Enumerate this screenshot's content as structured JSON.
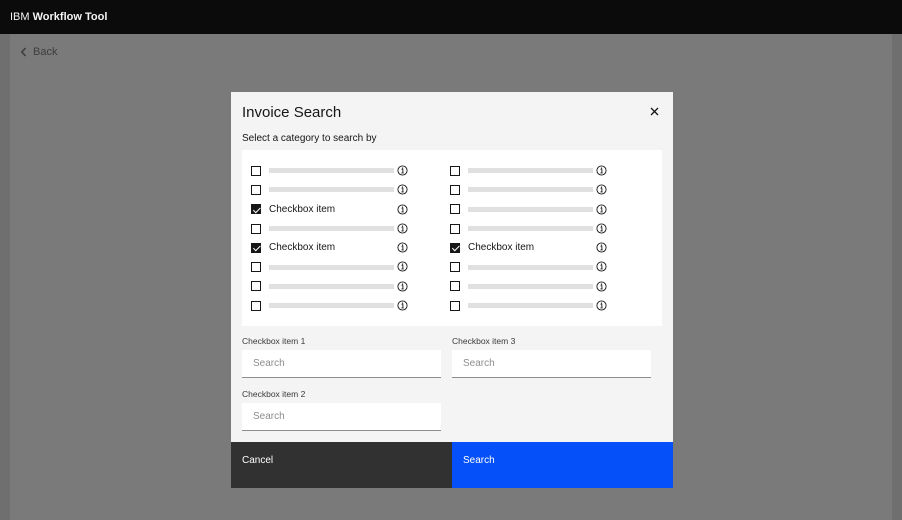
{
  "header": {
    "brand_prefix": "IBM",
    "brand_name": "Workflow Tool"
  },
  "nav": {
    "back_label": "Back"
  },
  "modal": {
    "title": "Invoice Search",
    "subtitle": "Select a category to search by",
    "checkboxes": {
      "left": [
        {
          "label": "",
          "checked": false
        },
        {
          "label": "",
          "checked": false
        },
        {
          "label": "Checkbox item",
          "checked": true
        },
        {
          "label": "",
          "checked": false
        },
        {
          "label": "Checkbox item",
          "checked": true
        },
        {
          "label": "",
          "checked": false
        },
        {
          "label": "",
          "checked": false
        },
        {
          "label": "",
          "checked": false
        }
      ],
      "right": [
        {
          "label": "",
          "checked": false
        },
        {
          "label": "",
          "checked": false
        },
        {
          "label": "",
          "checked": false
        },
        {
          "label": "",
          "checked": false
        },
        {
          "label": "Checkbox item",
          "checked": true
        },
        {
          "label": "",
          "checked": false
        },
        {
          "label": "",
          "checked": false
        },
        {
          "label": "",
          "checked": false
        }
      ]
    },
    "fields": [
      {
        "label": "Checkbox item 1",
        "placeholder": "Search",
        "value": ""
      },
      {
        "label": "Checkbox item 3",
        "placeholder": "Search",
        "value": ""
      },
      {
        "label": "Checkbox item 2",
        "placeholder": "Search",
        "value": ""
      }
    ],
    "cancel_label": "Cancel",
    "search_label": "Search"
  },
  "icons": {
    "back": "chevron-left-icon",
    "close": "close-icon",
    "info": "information-icon",
    "check": "checkmark-icon"
  },
  "colors": {
    "primary": "#0550f9",
    "secondary": "#313131",
    "header": "#0b0b0b",
    "overlay": "#7a7a7a"
  }
}
